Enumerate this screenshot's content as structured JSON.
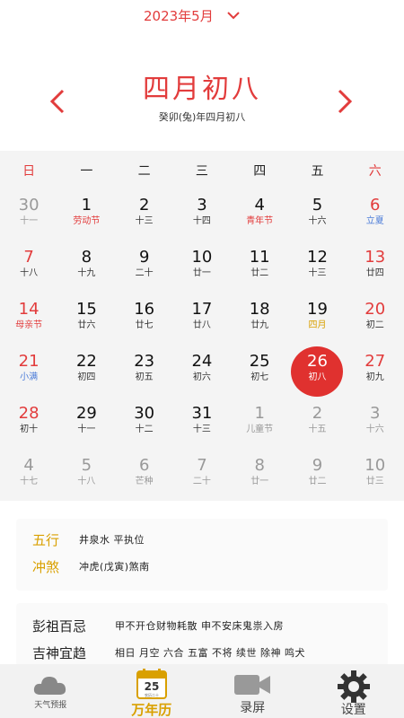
{
  "header": {
    "month_label": "2023年5月"
  },
  "hero": {
    "lunar_day": "四月初八",
    "lunar_full": "癸卯(兔)年四月初八"
  },
  "weekdays": [
    "日",
    "一",
    "二",
    "三",
    "四",
    "五",
    "六"
  ],
  "days": [
    {
      "num": "30",
      "sub": "十一",
      "other": true
    },
    {
      "num": "1",
      "sub": "劳动节",
      "sub_color": "red"
    },
    {
      "num": "2",
      "sub": "十三"
    },
    {
      "num": "3",
      "sub": "十四"
    },
    {
      "num": "4",
      "sub": "青年节",
      "sub_color": "red"
    },
    {
      "num": "5",
      "sub": "十六"
    },
    {
      "num": "6",
      "sub": "立夏",
      "sub_color": "blue"
    },
    {
      "num": "7",
      "sub": "十八"
    },
    {
      "num": "8",
      "sub": "十九"
    },
    {
      "num": "9",
      "sub": "二十"
    },
    {
      "num": "10",
      "sub": "廿一"
    },
    {
      "num": "11",
      "sub": "廿二"
    },
    {
      "num": "12",
      "sub": "十三"
    },
    {
      "num": "13",
      "sub": "廿四"
    },
    {
      "num": "14",
      "sub": "母亲节",
      "sub_color": "red"
    },
    {
      "num": "15",
      "sub": "廿六"
    },
    {
      "num": "16",
      "sub": "廿七"
    },
    {
      "num": "17",
      "sub": "廿八"
    },
    {
      "num": "18",
      "sub": "廿九"
    },
    {
      "num": "19",
      "sub": "四月",
      "sub_color": "gold"
    },
    {
      "num": "20",
      "sub": "初二"
    },
    {
      "num": "21",
      "sub": "小满",
      "sub_color": "blue"
    },
    {
      "num": "22",
      "sub": "初四"
    },
    {
      "num": "23",
      "sub": "初五"
    },
    {
      "num": "24",
      "sub": "初六"
    },
    {
      "num": "25",
      "sub": "初七"
    },
    {
      "num": "26",
      "sub": "初八",
      "selected": true
    },
    {
      "num": "27",
      "sub": "初九"
    },
    {
      "num": "28",
      "sub": "初十"
    },
    {
      "num": "29",
      "sub": "十一"
    },
    {
      "num": "30",
      "sub": "十二"
    },
    {
      "num": "31",
      "sub": "十三"
    },
    {
      "num": "1",
      "sub": "儿童节",
      "other": true
    },
    {
      "num": "2",
      "sub": "十五",
      "other": true
    },
    {
      "num": "3",
      "sub": "十六",
      "other": true
    },
    {
      "num": "4",
      "sub": "十七",
      "other": true
    },
    {
      "num": "5",
      "sub": "十八",
      "other": true
    },
    {
      "num": "6",
      "sub": "芒种",
      "other": true
    },
    {
      "num": "7",
      "sub": "二十",
      "other": true
    },
    {
      "num": "8",
      "sub": "廿一",
      "other": true
    },
    {
      "num": "9",
      "sub": "廿二",
      "other": true
    },
    {
      "num": "10",
      "sub": "廿三",
      "other": true
    }
  ],
  "info1": {
    "wuxing_label": "五行",
    "wuxing_value": "井泉水 平执位",
    "chongsha_label": "冲煞",
    "chongsha_value": "冲虎(戊寅)煞南"
  },
  "info2": {
    "pengzu_label": "彭祖百忌",
    "pengzu_value": "甲不开仓财物耗散 申不安床鬼祟入房",
    "jishen_label": "吉神宜趋",
    "jishen_value": "相日 月空 六合 五富 不将 续世 除神 鸣犬"
  },
  "tabs": {
    "weather": "天气预报",
    "calendar": "万年历",
    "calendar_icon_day": "25",
    "calendar_icon_sub": "农历二十",
    "record": "录屏",
    "settings": "设置"
  },
  "colors": {
    "accent_red": "#e23c3c",
    "gold": "#d9a000",
    "blue": "#4a7bd8"
  }
}
